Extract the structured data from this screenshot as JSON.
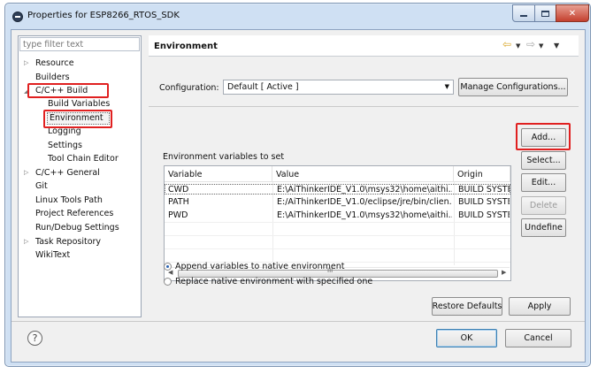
{
  "window": {
    "title": "Properties for ESP8266_RTOS_SDK",
    "icon": "eclipse-icon"
  },
  "tree": {
    "filter_placeholder": "type filter text",
    "items": [
      {
        "label": "Resource",
        "expandable": true
      },
      {
        "label": "Builders"
      },
      {
        "label": "C/C++ Build",
        "expanded": true
      },
      {
        "label": "Build Variables"
      },
      {
        "label": "Environment",
        "selected": true
      },
      {
        "label": "Logging"
      },
      {
        "label": "Settings"
      },
      {
        "label": "Tool Chain Editor"
      },
      {
        "label": "C/C++ General",
        "expandable": true
      },
      {
        "label": "Git"
      },
      {
        "label": "Linux Tools Path"
      },
      {
        "label": "Project References"
      },
      {
        "label": "Run/Debug Settings"
      },
      {
        "label": "Task Repository",
        "expandable": true
      },
      {
        "label": "WikiText"
      }
    ]
  },
  "page": {
    "title": "Environment",
    "configuration_label": "Configuration:",
    "configuration_value": "Default  [ Active ]",
    "manage_button": "Manage Configurations...",
    "env_vars_label": "Environment variables to set",
    "columns": [
      "Variable",
      "Value",
      "Origin"
    ],
    "rows": [
      {
        "variable": "CWD",
        "value": "E:\\AiThinkerIDE_V1.0\\msys32\\home\\aithi...",
        "origin": "BUILD SYSTEM"
      },
      {
        "variable": "PATH",
        "value": "E:/AiThinkerIDE_V1.0/eclipse/jre/bin/clien...",
        "origin": "BUILD SYSTEM"
      },
      {
        "variable": "PWD",
        "value": "E:\\AiThinkerIDE_V1.0\\msys32\\home\\aithi...",
        "origin": "BUILD SYSTEM"
      }
    ],
    "scroll_grip": "III",
    "side_buttons": {
      "add": "Add...",
      "select": "Select...",
      "edit": "Edit...",
      "delete": "Delete",
      "undefine": "Undefine"
    },
    "radio_append": "Append variables to native environment",
    "radio_replace": "Replace native environment with specified one",
    "restore_defaults": "Restore Defaults",
    "apply": "Apply"
  },
  "footer": {
    "help": "?",
    "ok": "OK",
    "cancel": "Cancel"
  },
  "colors": {
    "highlight": "#e02020",
    "window_frame": "#cfe0f3"
  }
}
